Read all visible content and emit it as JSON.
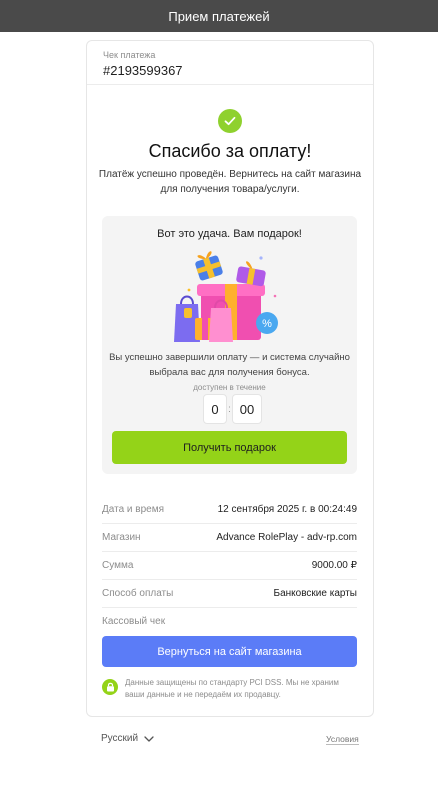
{
  "header": {
    "title": "Прием платежей"
  },
  "receipt": {
    "label": "Чек платежа",
    "number": "#2193599367"
  },
  "success": {
    "title": "Спасибо за оплату!",
    "text": "Платёж успешно проведён. Вернитесь на сайт магазина для получения товара/услуги."
  },
  "gift": {
    "title": "Вот это удача. Вам подарок!",
    "text": "Вы успешно завершили оплату — и система случайно выбрала вас для получения бонуса.",
    "available_label": "доступен в течение",
    "timer": {
      "minutes": "0",
      "seconds": "00"
    },
    "button_label": "Получить подарок"
  },
  "details": [
    {
      "label": "Дата и время",
      "value": "12 сентября 2025 г. в 00:24:49"
    },
    {
      "label": "Магазин",
      "value": "Advance RolePlay - adv-rp.com"
    },
    {
      "label": "Сумма",
      "value": "9000.00 ₽"
    },
    {
      "label": "Способ оплаты",
      "value": "Банковские карты"
    },
    {
      "label": "Кассовый чек",
      "value": ""
    }
  ],
  "return_button": "Вернуться на сайт магазина",
  "security_text": "Данные защищены по стандарту PCI DSS. Мы не храним ваши данные и не передаём их продавцу.",
  "footer": {
    "language": "Русский",
    "terms": "Условия"
  },
  "colors": {
    "accent_green": "#94d318",
    "primary_blue": "#5b7cf7",
    "topbar": "#4a4a4a"
  }
}
